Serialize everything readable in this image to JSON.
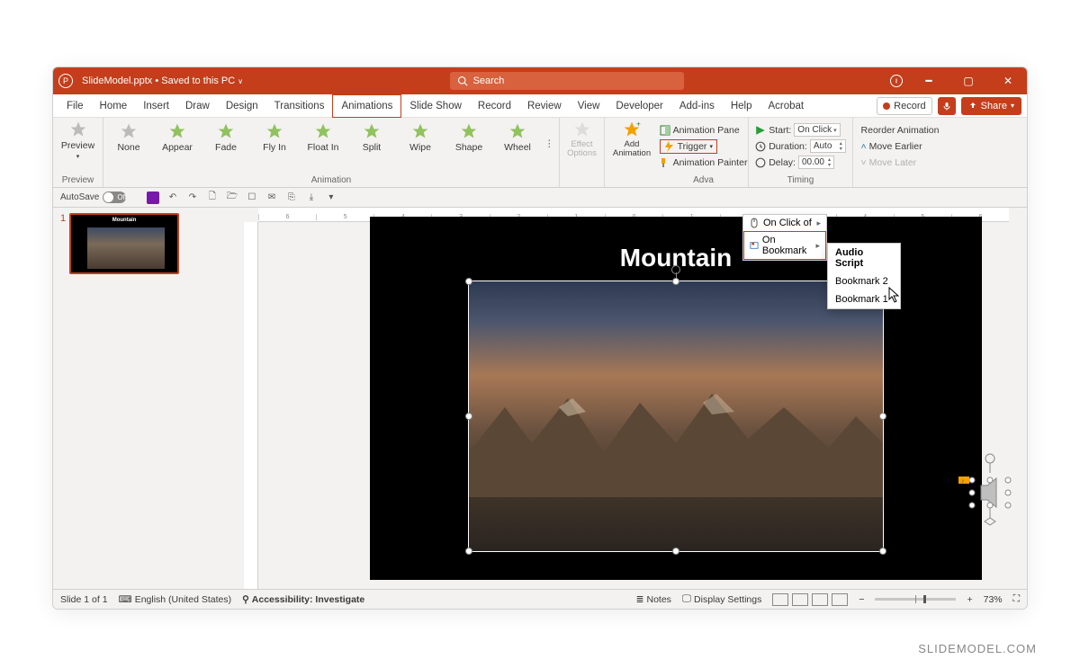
{
  "title": {
    "filename": "SlideModel.pptx",
    "saved_status": "Saved to this PC"
  },
  "search": {
    "placeholder": "Search"
  },
  "tabs": [
    "File",
    "Home",
    "Insert",
    "Draw",
    "Design",
    "Transitions",
    "Animations",
    "Slide Show",
    "Record",
    "Review",
    "View",
    "Developer",
    "Add-ins",
    "Help",
    "Acrobat"
  ],
  "active_tab_index": 6,
  "end_tools": {
    "record": "Record",
    "share": "Share"
  },
  "ribbon": {
    "preview": {
      "btn": "Preview",
      "section": "Preview"
    },
    "animation": {
      "items": [
        "None",
        "Appear",
        "Fade",
        "Fly In",
        "Float In",
        "Split",
        "Wipe",
        "Shape",
        "Wheel"
      ],
      "section": "Animation"
    },
    "effect_options": "Effect Options",
    "add_animation": "Add Animation",
    "advanced": {
      "pane": "Animation Pane",
      "trigger": "Trigger",
      "painter": "Animation Painter",
      "section": "Advanced Animation"
    },
    "timing": {
      "start_label": "Start:",
      "start_value": "On Click",
      "duration_label": "Duration:",
      "duration_value": "Auto",
      "delay_label": "Delay:",
      "delay_value": "00.00",
      "section": "Timing"
    },
    "reorder": {
      "title": "Reorder Animation",
      "earlier": "Move Earlier",
      "later": "Move Later"
    }
  },
  "trigger_menu": {
    "on_click_of": "On Click of",
    "on_bookmark": "On Bookmark"
  },
  "bookmark_submenu": {
    "header": "Audio Script",
    "items": [
      "Bookmark 2",
      "Bookmark 1"
    ]
  },
  "qat": {
    "autosave": "AutoSave",
    "autosave_state": "Off"
  },
  "slide": {
    "number": "1",
    "title": "Mountain"
  },
  "status": {
    "page": "Slide 1 of 1",
    "lang": "English (United States)",
    "accessibility": "Accessibility: Investigate",
    "notes": "Notes",
    "display": "Display Settings",
    "zoom_pct": "73%"
  },
  "ruler_marks": [
    "6",
    "5",
    "4",
    "3",
    "2",
    "1",
    "0",
    "1",
    "2",
    "3",
    "4",
    "5",
    "6"
  ],
  "watermark": "SLIDEMODEL.COM"
}
